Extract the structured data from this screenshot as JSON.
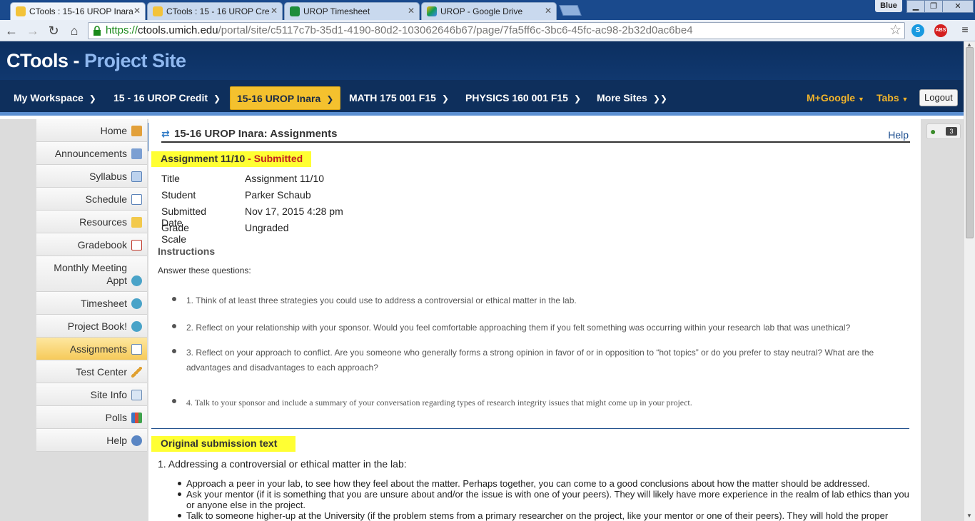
{
  "browser": {
    "tabs": [
      {
        "label": "CTools : 15-16 UROP Inara",
        "favicon": "ctools-icon"
      },
      {
        "label": "CTools : 15 - 16 UROP Cre",
        "favicon": "ctools-icon"
      },
      {
        "label": "UROP Timesheet",
        "favicon": "timesheet-icon"
      },
      {
        "label": "UROP - Google Drive",
        "favicon": "google-drive-icon"
      }
    ],
    "profile_name": "Blue",
    "url": {
      "scheme": "https://",
      "host": "ctools.umich.edu",
      "path": "/portal/site/c5117c7b-35d1-4190-80d2-103062646b67/page/7fa5ff6c-3bc6-45fc-ac98-2b32d0ac6be4"
    },
    "extension_badge": "ABS"
  },
  "site": {
    "brand_prefix": "CTools - ",
    "brand_suffix": "Project Site",
    "nav": [
      {
        "label": "My Workspace"
      },
      {
        "label": "15 - 16 UROP Credit"
      },
      {
        "label": "15-16 UROP Inara"
      },
      {
        "label": "MATH 175 001 F15"
      },
      {
        "label": "PHYSICS 160 001 F15"
      },
      {
        "label": "More Sites"
      }
    ],
    "mgoogle": "M+Google",
    "tabs_label": "Tabs",
    "logout": "Logout"
  },
  "tool_menu": [
    {
      "label": "Home",
      "icon": "home-icon"
    },
    {
      "label": "Announcements",
      "icon": "megaphone-icon"
    },
    {
      "label": "Syllabus",
      "icon": "syllabus-icon"
    },
    {
      "label": "Schedule",
      "icon": "calendar-icon"
    },
    {
      "label": "Resources",
      "icon": "folder-icon"
    },
    {
      "label": "Gradebook",
      "icon": "gradebook-icon"
    },
    {
      "label": "Monthly Meeting",
      "label2": "Appt",
      "icon": "web-content-icon"
    },
    {
      "label": "Timesheet",
      "icon": "web-content-icon"
    },
    {
      "label": "Project Book!",
      "icon": "web-content-icon"
    },
    {
      "label": "Assignments",
      "icon": "assignment-icon"
    },
    {
      "label": "Test Center",
      "icon": "pencil-icon"
    },
    {
      "label": "Site Info",
      "icon": "site-info-icon"
    },
    {
      "label": "Polls",
      "icon": "bar-chart-icon"
    },
    {
      "label": "Help",
      "icon": "help-icon"
    }
  ],
  "presence_count": "3",
  "content": {
    "page_title": "15-16 UROP Inara: Assignments",
    "help": "Help",
    "assignment_heading": "Assignment 11/10",
    "assignment_sep": " - ",
    "assignment_status": "Submitted",
    "details": [
      {
        "label": "Title",
        "value": "Assignment 11/10"
      },
      {
        "label": "Student",
        "value": "Parker Schaub"
      },
      {
        "label": "Submitted Date",
        "value": "Nov 17, 2015 4:28 pm"
      },
      {
        "label": "Grade Scale",
        "value": "Ungraded"
      }
    ],
    "instructions_heading": "Instructions",
    "instructions_intro": "Answer these questions:",
    "questions": [
      "1. Think of at least three strategies you could use to address a controversial or ethical matter in the lab.",
      "2. Reflect on your relationship with your sponsor. Would you feel comfortable approaching them if you felt something was occurring within your research lab that was unethical?",
      "3. Reflect on your approach to conflict. Are you someone who generally forms a strong opinion in favor of or in opposition to “hot topics” or do you prefer to stay neutral? What are the advantages and disadvantages to each approach?",
      "4. Talk to your sponsor and include a summary of your conversation regarding types of research integrity issues that might come up in your project."
    ],
    "submission_heading": "Original submission text",
    "submission_numbered": "1. Addressing a controversial or ethical matter in the lab:",
    "submission_bullets": [
      "Approach a peer in your lab, to see how they feel about the matter. Perhaps together, you can come to a good conclusions about how the matter should be addressed.",
      "Ask your mentor (if it is something that you are unsure about and/or the issue is with one of your peers). They will likely have more experience in the realm of lab ethics than you or anyone else in the project.",
      "Talk to someone higher-up at the University (if the problem stems from a primary researcher on the project, like your mentor or one of their peers). They will hold the proper"
    ]
  }
}
